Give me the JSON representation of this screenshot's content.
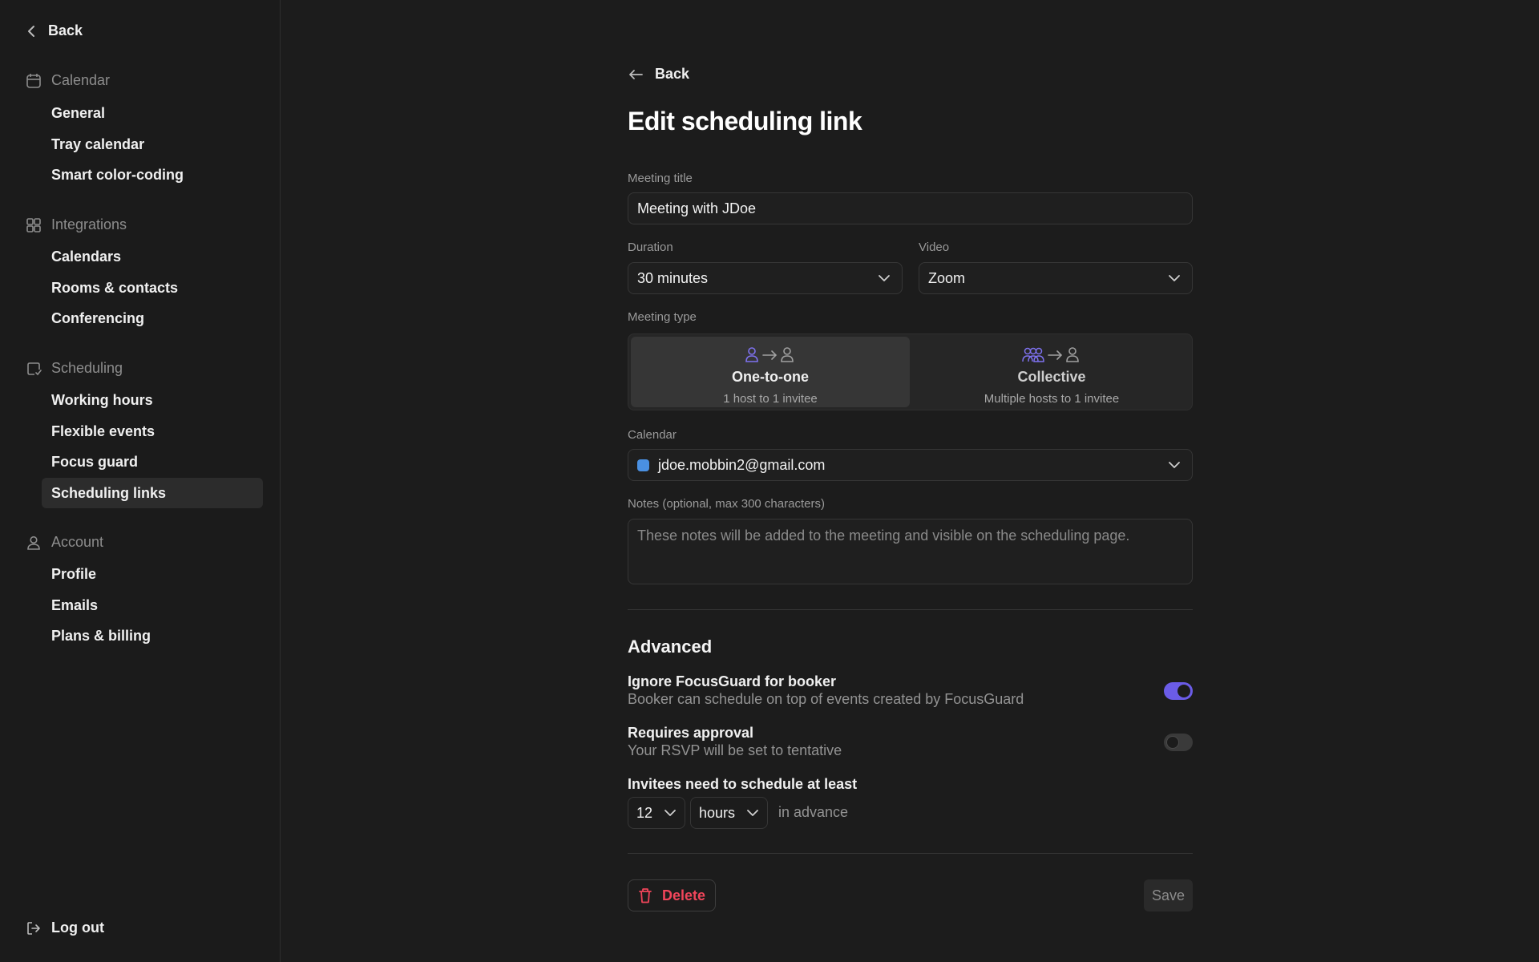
{
  "sidebar": {
    "back_label": "Back",
    "sections": [
      {
        "title": "Calendar",
        "icon": "calendar-icon",
        "items": [
          "General",
          "Tray calendar",
          "Smart color-coding"
        ]
      },
      {
        "title": "Integrations",
        "icon": "integrations-icon",
        "items": [
          "Calendars",
          "Rooms & contacts",
          "Conferencing"
        ]
      },
      {
        "title": "Scheduling",
        "icon": "scheduling-icon",
        "items": [
          "Working hours",
          "Flexible events",
          "Focus guard",
          "Scheduling links"
        ]
      },
      {
        "title": "Account",
        "icon": "account-icon",
        "items": [
          "Profile",
          "Emails",
          "Plans & billing"
        ]
      }
    ],
    "active_item": "Scheduling links",
    "logout_label": "Log out"
  },
  "main": {
    "back_label": "Back",
    "title": "Edit scheduling link",
    "meeting_title": {
      "label": "Meeting title",
      "value": "Meeting with JDoe"
    },
    "duration": {
      "label": "Duration",
      "value": "30 minutes"
    },
    "video": {
      "label": "Video",
      "value": "Zoom"
    },
    "meeting_type": {
      "label": "Meeting type",
      "options": [
        {
          "title": "One-to-one",
          "subtitle": "1 host to 1 invitee",
          "selected": true
        },
        {
          "title": "Collective",
          "subtitle": "Multiple hosts to 1 invitee",
          "selected": false
        }
      ]
    },
    "calendar": {
      "label": "Calendar",
      "value": "jdoe.mobbin2@gmail.com",
      "color": "#4a90e2"
    },
    "notes": {
      "label": "Notes (optional, max 300 characters)",
      "placeholder": "These notes will be added to the meeting and visible on the scheduling page."
    },
    "advanced": {
      "title": "Advanced",
      "ignore_focusguard": {
        "title": "Ignore FocusGuard for booker",
        "subtitle": "Booker can schedule on top of events created by FocusGuard",
        "enabled": true
      },
      "requires_approval": {
        "title": "Requires approval",
        "subtitle": "Your RSVP will be set to tentative",
        "enabled": false
      },
      "min_notice": {
        "title": "Invitees need to schedule at least",
        "amount": "12",
        "unit": "hours",
        "suffix": "in advance"
      }
    },
    "delete_label": "Delete",
    "save_label": "Save"
  },
  "colors": {
    "accent": "#6b5ce7",
    "danger": "#f0455a",
    "background": "#1c1c1c"
  }
}
